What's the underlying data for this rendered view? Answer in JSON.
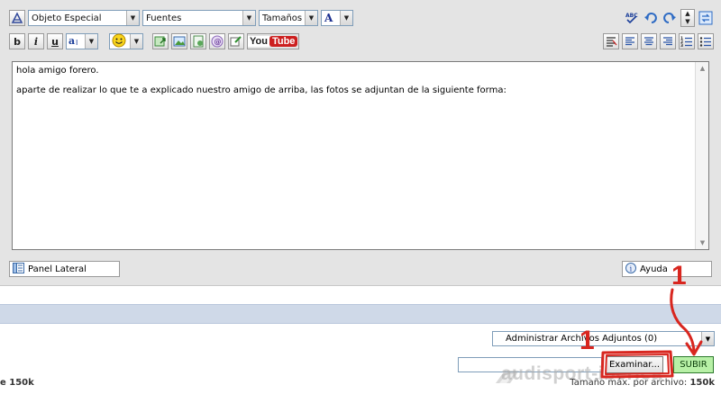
{
  "toolbar": {
    "row1": {
      "special_object": "Objeto Especial",
      "fonts": "Fuentes",
      "sizes": "Tamaños",
      "font_color_glyph": "A"
    },
    "row2": {
      "bold": "b",
      "italic": "i",
      "underline": "u",
      "youtube_left": "You",
      "youtube_right": "Tube"
    }
  },
  "editor": {
    "lines": [
      "hola amigo forero.",
      "aparte de realizar lo que te a explicado nuestro amigo de arriba, las fotos se adjuntan de la siguiente forma:"
    ]
  },
  "panel_lateral": "Panel Lateral",
  "ayuda": "Ayuda",
  "attachments": {
    "manage_select": "Administrar Archivos Adjuntos (0)",
    "browse_button": "Examinar...",
    "upload_button": "SUBIR",
    "max_size_left": "e 150k",
    "max_size_label": "Tamaño máx. por archivo:",
    "max_size_value": "150k"
  },
  "watermark": "audisport-iberica",
  "annotations": {
    "marker_1": "1",
    "marker_2": "1",
    "color": "#d8261f"
  },
  "colors": {
    "editor_bg": "#e4e4e4",
    "band": "#cfd9e8",
    "upload_button_bg": "#b7f0a6",
    "annotation_red": "#d8261f"
  }
}
